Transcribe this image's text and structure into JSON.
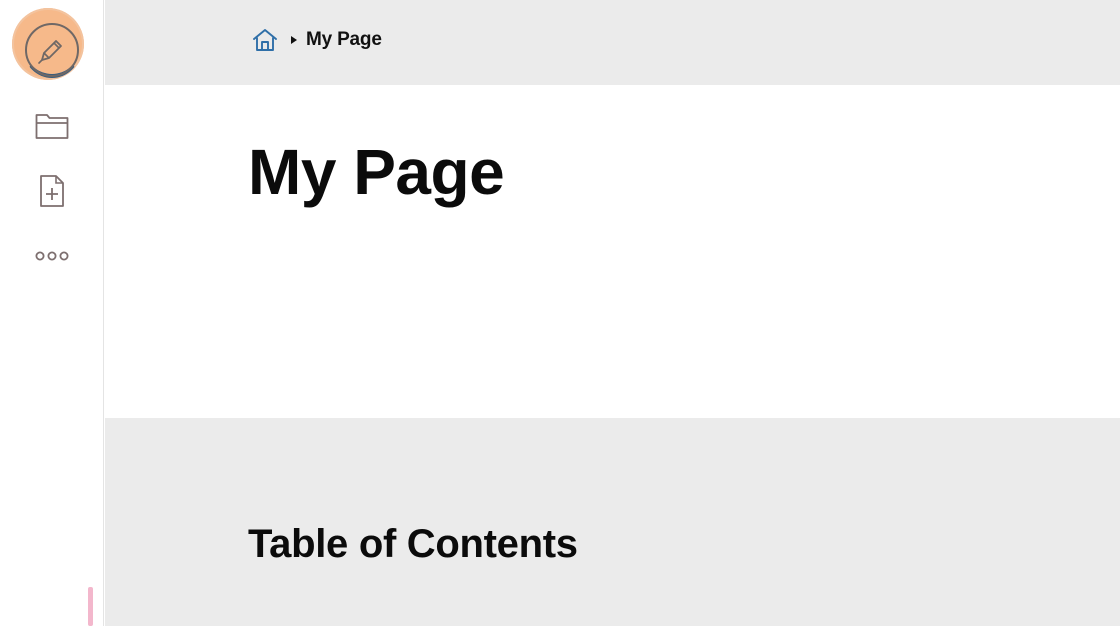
{
  "sidebar": {
    "icons": {
      "edit": "pencil-icon",
      "folder": "folder-icon",
      "new_page": "new-page-icon",
      "more": "more-icon"
    },
    "colors": {
      "edit_highlight": "#f6b98a",
      "icon_stroke": "#7d6f6f"
    }
  },
  "header": {
    "home_icon": "home-icon",
    "breadcrumb_current": "My Page"
  },
  "page": {
    "title": "My Page",
    "toc_heading": "Table of Contents"
  },
  "colors": {
    "header_bg": "#ebebeb",
    "hero_bg": "#ffffff",
    "home_icon": "#2f6fa8",
    "text": "#0b0b0b"
  }
}
